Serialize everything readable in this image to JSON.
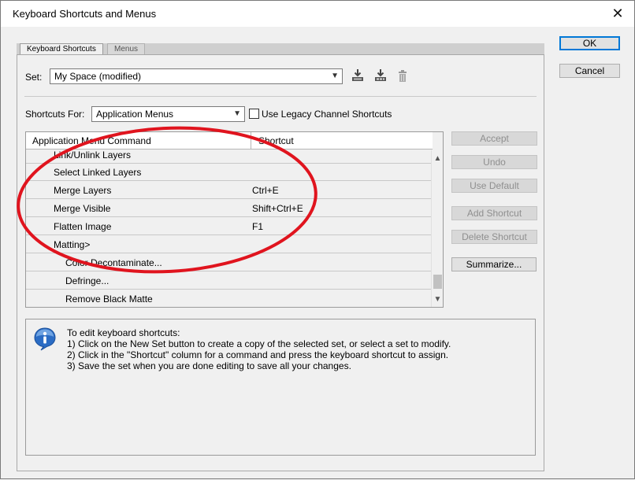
{
  "window": {
    "title": "Keyboard Shortcuts and Menus",
    "close_glyph": "✕"
  },
  "side_buttons": {
    "ok": "OK",
    "cancel": "Cancel"
  },
  "tabs": [
    {
      "label": "Keyboard Shortcuts",
      "active": true
    },
    {
      "label": "Menus",
      "active": false
    }
  ],
  "set": {
    "label": "Set:",
    "value": "My Space (modified)"
  },
  "shortcuts_for": {
    "label": "Shortcuts For:",
    "value": "Application Menus",
    "legacy_label": "Use Legacy Channel Shortcuts",
    "legacy_checked": false
  },
  "table": {
    "headers": [
      "Application Menu Command",
      "Shortcut"
    ],
    "rows": [
      {
        "command": "Link/Unlink Layers",
        "shortcut": "",
        "indent": 1
      },
      {
        "command": "Select Linked Layers",
        "shortcut": "",
        "indent": 1
      },
      {
        "command": "Merge Layers",
        "shortcut": "Ctrl+E",
        "indent": 1
      },
      {
        "command": "Merge Visible",
        "shortcut": "Shift+Ctrl+E",
        "indent": 1
      },
      {
        "command": "Flatten Image",
        "shortcut": "F1",
        "indent": 1
      },
      {
        "command": "Matting>",
        "shortcut": "",
        "indent": 1
      },
      {
        "command": "Color Decontaminate...",
        "shortcut": "",
        "indent": 2
      },
      {
        "command": "Defringe...",
        "shortcut": "",
        "indent": 2
      },
      {
        "command": "Remove Black Matte",
        "shortcut": "",
        "indent": 2
      }
    ]
  },
  "actions": {
    "accept": "Accept",
    "undo": "Undo",
    "use_default": "Use Default",
    "add_shortcut": "Add Shortcut",
    "delete_shortcut": "Delete Shortcut",
    "summarize": "Summarize..."
  },
  "info": {
    "lines": [
      "To edit keyboard shortcuts:",
      "1) Click on the New Set button to create a copy of the selected set, or select a set to modify.",
      "2) Click in the \"Shortcut\" column for a command and press the keyboard shortcut to assign.",
      "3) Save the set when you are done editing to save all your changes."
    ]
  },
  "colors": {
    "annotation": "#e0141e",
    "accent": "#0078d7",
    "info_icon": "#2b6cc4"
  },
  "icons": {
    "save_set": "save-set-icon",
    "save_set_as": "save-set-as-icon",
    "delete_set": "trash-icon",
    "info": "info-icon"
  }
}
